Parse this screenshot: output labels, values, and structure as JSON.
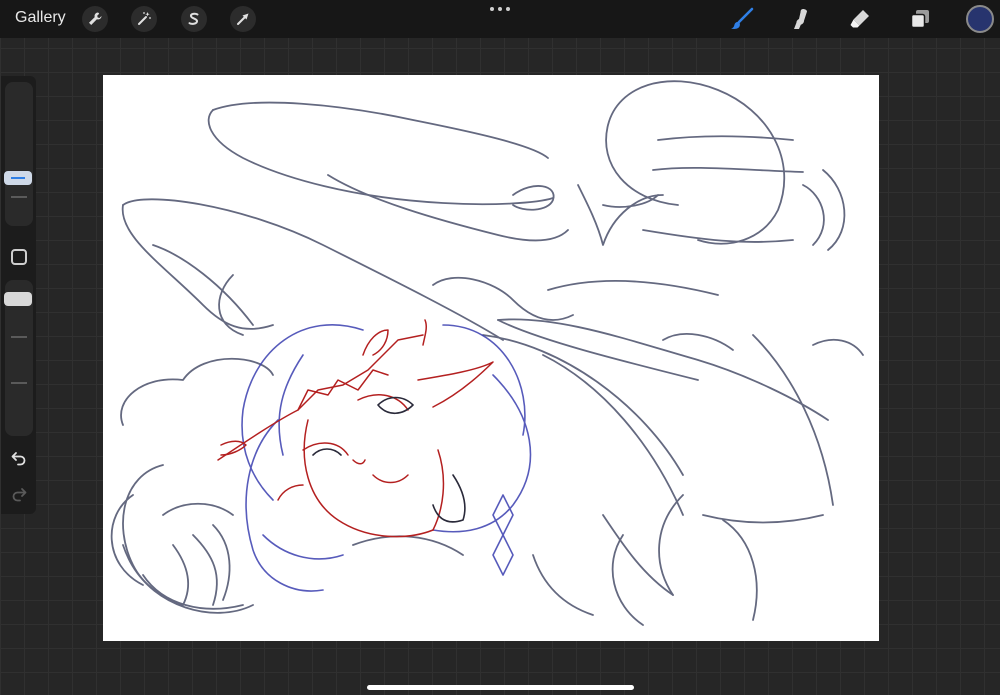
{
  "topbar": {
    "gallery_label": "Gallery",
    "left_tools": [
      "wrench-icon",
      "magic-wand-icon",
      "selection-icon",
      "transform-arrow-icon"
    ],
    "right_tools": [
      "brush-icon",
      "smudge-icon",
      "eraser-icon",
      "layers-icon"
    ],
    "active_tool": "brush",
    "accent_color": "#2f7fe6",
    "current_color": "#27346e"
  },
  "sidebar": {
    "brush_size_level": 0.28,
    "brush_opacity_level": 1.0
  },
  "canvas": {
    "background": "#ffffff",
    "sketch_colors": [
      "#4a4f6a",
      "#3a3fb0",
      "#b42020"
    ]
  }
}
